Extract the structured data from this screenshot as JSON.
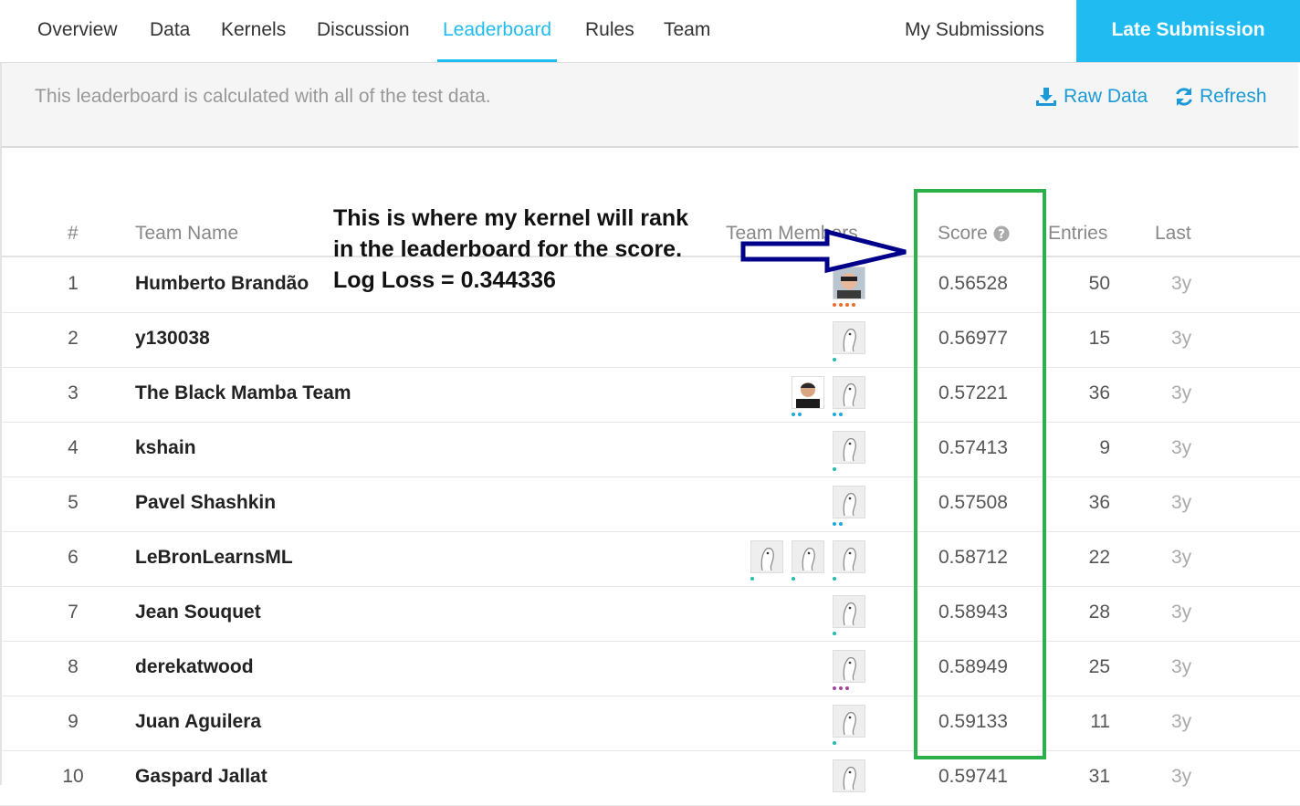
{
  "nav": {
    "tabs": [
      {
        "label": "Overview"
      },
      {
        "label": "Data"
      },
      {
        "label": "Kernels"
      },
      {
        "label": "Discussion"
      },
      {
        "label": "Leaderboard"
      },
      {
        "label": "Rules"
      },
      {
        "label": "Team"
      }
    ],
    "active_tab": "Leaderboard",
    "my_submissions": "My Submissions",
    "late_submission": "Late Submission"
  },
  "info": {
    "text": "This leaderboard is calculated with all of the test data.",
    "raw_data": "Raw Data",
    "refresh": "Refresh"
  },
  "table": {
    "headers": {
      "rank": "#",
      "team_name": "Team Name",
      "team_members": "Team Members",
      "score": "Score",
      "entries": "Entries",
      "last": "Last"
    },
    "rows": [
      {
        "rank": "1",
        "team": "Humberto Brandão",
        "score": "0.56528",
        "entries": "50",
        "last": "3y"
      },
      {
        "rank": "2",
        "team": "y130038",
        "score": "0.56977",
        "entries": "15",
        "last": "3y"
      },
      {
        "rank": "3",
        "team": "The Black Mamba Team",
        "score": "0.57221",
        "entries": "36",
        "last": "3y"
      },
      {
        "rank": "4",
        "team": "kshain",
        "score": "0.57413",
        "entries": "9",
        "last": "3y"
      },
      {
        "rank": "5",
        "team": "Pavel Shashkin",
        "score": "0.57508",
        "entries": "36",
        "last": "3y"
      },
      {
        "rank": "6",
        "team": "LeBronLearnsML",
        "score": "0.58712",
        "entries": "22",
        "last": "3y"
      },
      {
        "rank": "7",
        "team": "Jean Souquet",
        "score": "0.58943",
        "entries": "28",
        "last": "3y"
      },
      {
        "rank": "8",
        "team": "derekatwood",
        "score": "0.58949",
        "entries": "25",
        "last": "3y"
      },
      {
        "rank": "9",
        "team": "Juan Aguilera",
        "score": "0.59133",
        "entries": "11",
        "last": "3y"
      },
      {
        "rank": "10",
        "team": "Gaspard Jallat",
        "score": "0.59741",
        "entries": "31",
        "last": "3y"
      }
    ]
  },
  "annotation": {
    "line1": "This is where my kernel will rank",
    "line2": "in the leaderboard for the score.",
    "line3": "Log Loss = 0.344336"
  },
  "colors": {
    "accent": "#20bbf0",
    "link": "#1a9ad6",
    "highlight_box": "#2bb04a",
    "arrow": "#00008b"
  }
}
